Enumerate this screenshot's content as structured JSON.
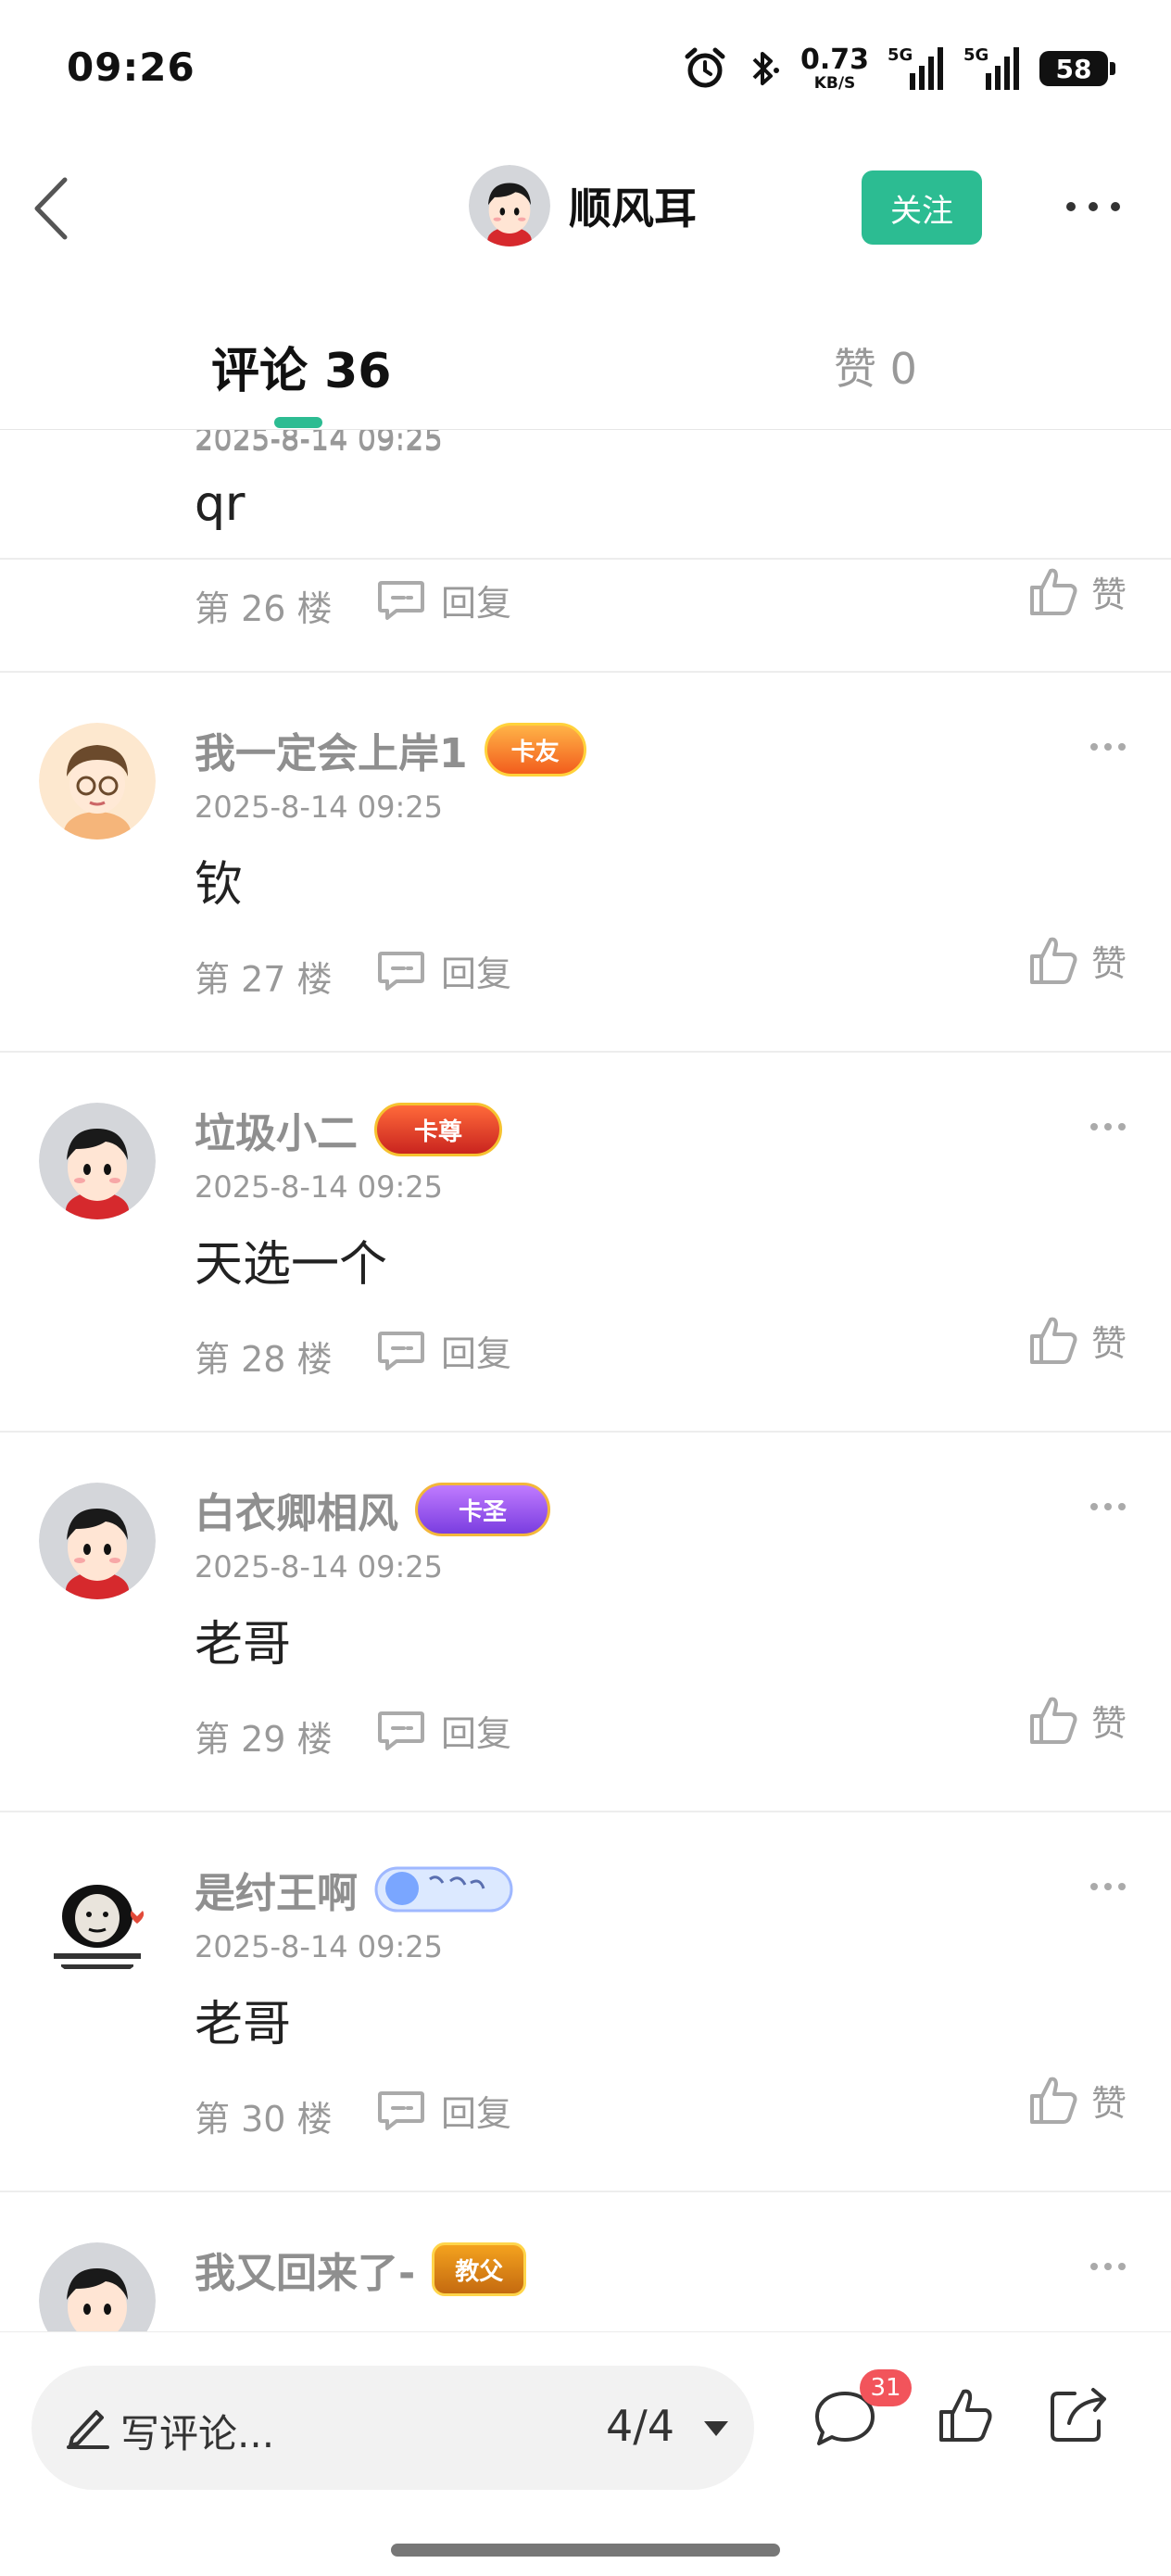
{
  "status_bar": {
    "time": "09:26",
    "net_speed": "0.73",
    "net_unit": "KB/S",
    "signal_1": "5G",
    "signal_2": "5G",
    "battery": "58"
  },
  "header": {
    "author_name": "顺风耳",
    "follow_label": "关注"
  },
  "tabs": [
    {
      "label": "评论 36",
      "active": true
    },
    {
      "label": "赞 0",
      "active": false
    }
  ],
  "comments": [
    {
      "name": "",
      "badge": "",
      "date": "2025-8-14 09:25",
      "text": "qr",
      "floor": "第 26 楼",
      "reply": "回复",
      "like": "赞"
    },
    {
      "name": "我一定会上岸1",
      "badge": "卡友",
      "date": "2025-8-14 09:25",
      "text": "钦",
      "floor": "第 27 楼",
      "reply": "回复",
      "like": "赞"
    },
    {
      "name": "垃圾小二",
      "badge": "卡尊",
      "date": "2025-8-14 09:25",
      "text": "天选一个",
      "floor": "第 28 楼",
      "reply": "回复",
      "like": "赞"
    },
    {
      "name": "白衣卿相风",
      "badge": "卡圣",
      "date": "2025-8-14 09:25",
      "text": "老哥",
      "floor": "第 29 楼",
      "reply": "回复",
      "like": "赞"
    },
    {
      "name": "是纣王啊",
      "badge": "",
      "date": "2025-8-14 09:25",
      "text": "老哥",
      "floor": "第 30 楼",
      "reply": "回复",
      "like": "赞"
    },
    {
      "name": "我又回来了-",
      "badge": "教父",
      "date": "",
      "text": "",
      "floor": "",
      "reply": "",
      "like": ""
    }
  ],
  "bottom_bar": {
    "write_placeholder": "写评论...",
    "page_indicator": "4/4",
    "comment_count": "31"
  },
  "colors": {
    "accent": "#2cbc92",
    "badge_red": "#f2545b",
    "muted_text": "#999999"
  },
  "icons": [
    "back-icon",
    "more-icon",
    "reply-icon",
    "thumb-up-icon",
    "pencil-icon",
    "caret-down-icon",
    "comment-bubble-icon",
    "share-icon",
    "alarm-icon",
    "bluetooth-icon"
  ]
}
